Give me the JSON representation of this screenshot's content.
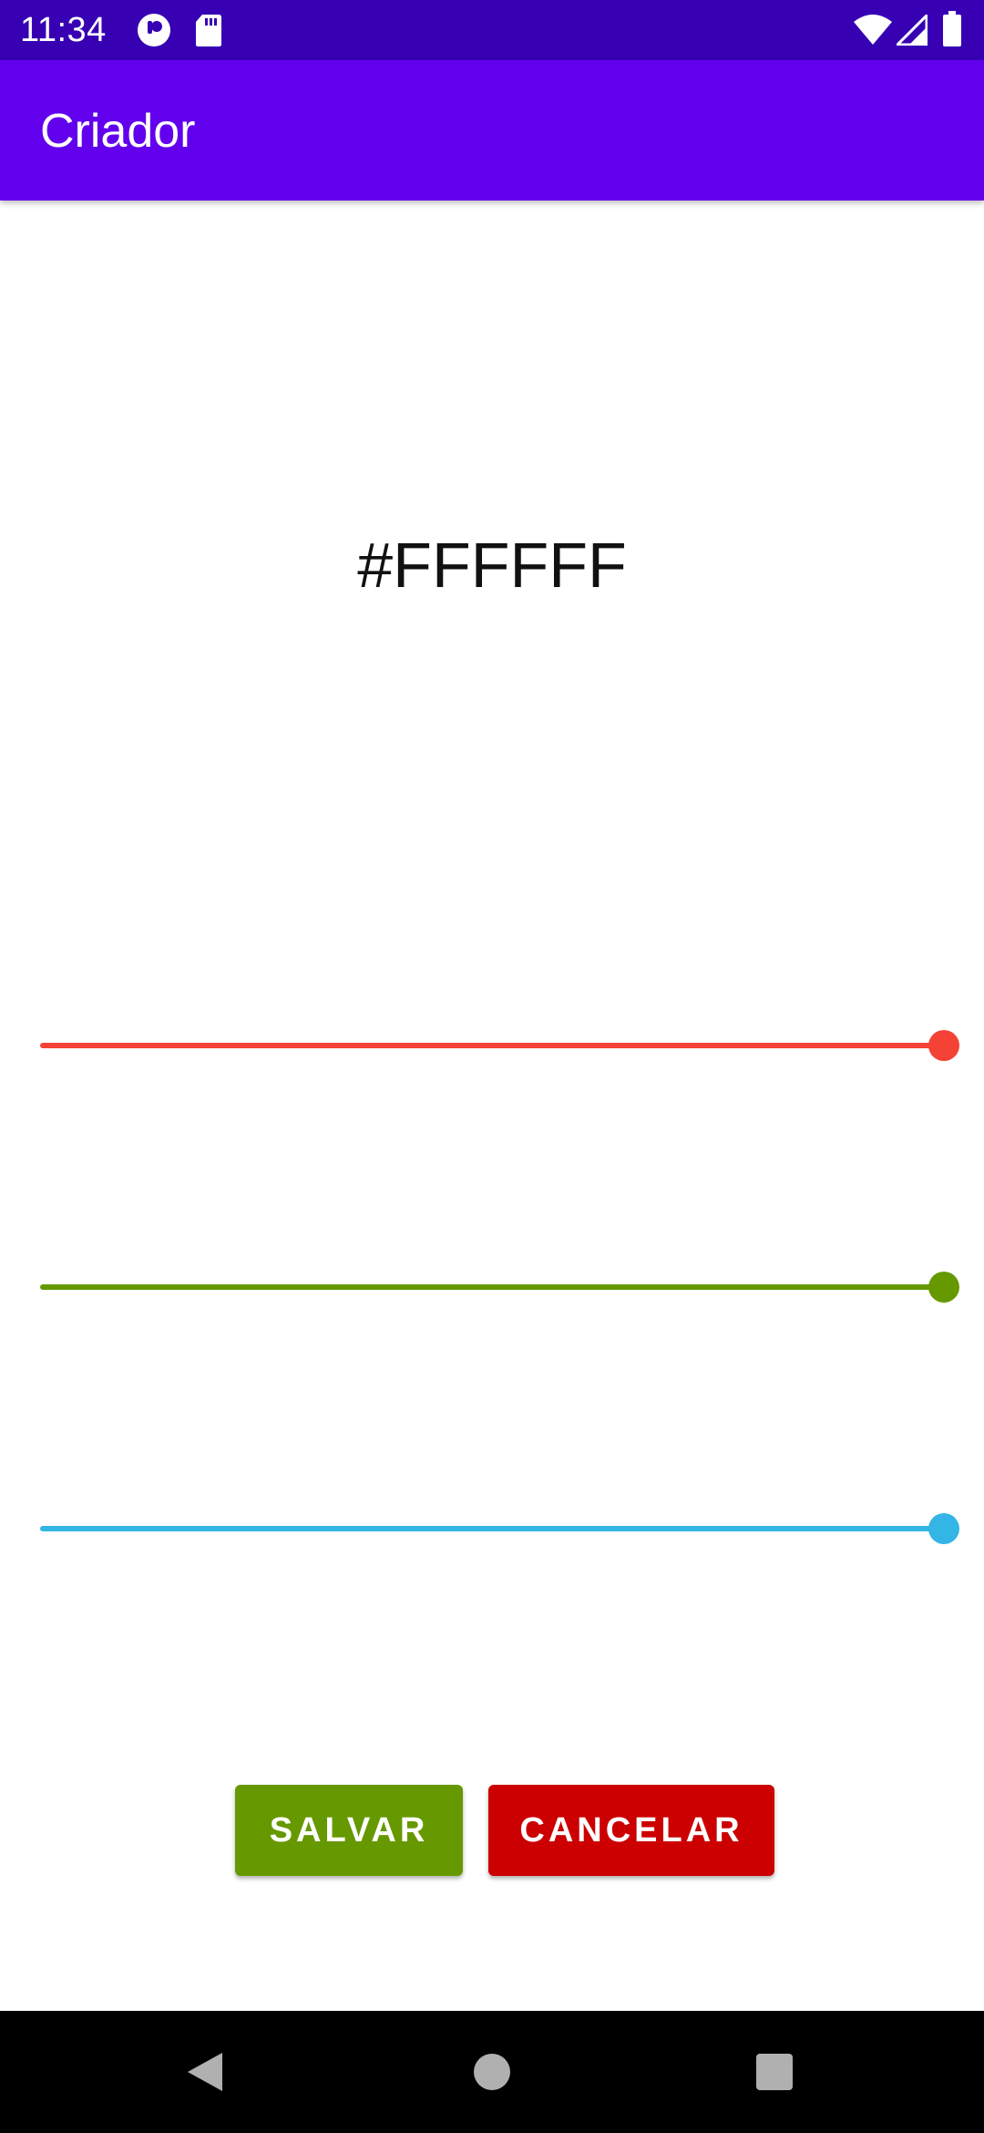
{
  "status_bar": {
    "time": "11:34",
    "icons": [
      "app-notification-icon",
      "sd-card-icon",
      "wifi-icon",
      "cell-signal-icon",
      "battery-icon"
    ]
  },
  "app_bar": {
    "title": "Criador"
  },
  "color_preview": {
    "hex": "#FFFFFF"
  },
  "sliders": [
    {
      "name": "red-slider",
      "color": "#f44336",
      "value": 1.0
    },
    {
      "name": "green-slider",
      "color": "#669900",
      "value": 1.0
    },
    {
      "name": "blue-slider",
      "color": "#33b5e5",
      "value": 1.0
    }
  ],
  "buttons": {
    "save_label": "SALVAR",
    "save_color": "#669900",
    "cancel_label": "CANCELAR",
    "cancel_color": "#cc0000"
  },
  "nav_bar": {
    "icons": [
      "back-icon",
      "home-icon",
      "recents-icon"
    ]
  },
  "colors": {
    "status_bar": "#3700b3",
    "app_bar": "#6200ee"
  }
}
